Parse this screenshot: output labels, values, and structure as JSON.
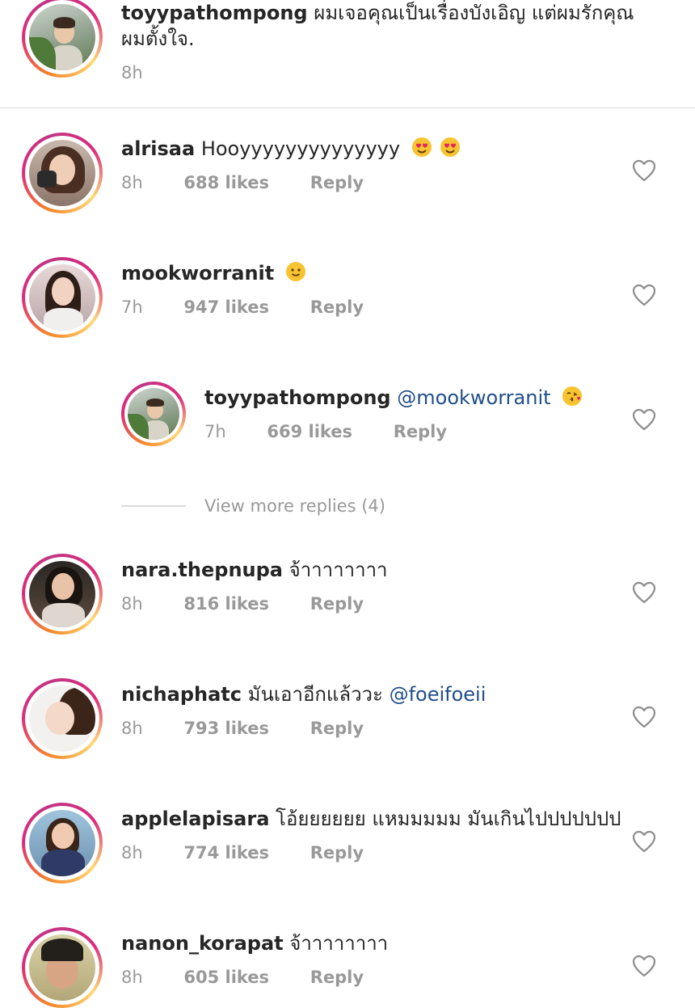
{
  "caption": {
    "username": "toyypathompong",
    "text_line1": "ผมเจอคุณเป็นเรื่องบังเอิญ แต่ผมรักคุณ",
    "text_line2": "ผมตั้งใจ.",
    "time": "8h"
  },
  "reply_label": "Reply",
  "comments": [
    {
      "username": "alrisaa",
      "text": "Hooyyyyyyyyyyyyyy",
      "emojis": [
        "heart-eyes",
        "heart-eyes"
      ],
      "time": "8h",
      "likes": "688 likes"
    },
    {
      "username": "mookworranit",
      "text": "",
      "emojis": [
        "slight-smile"
      ],
      "time": "7h",
      "likes": "947 likes"
    },
    {
      "username": "toyypathompong",
      "text": "",
      "mention": "@mookworranit",
      "emojis": [
        "kiss"
      ],
      "time": "7h",
      "likes": "669 likes",
      "is_reply": true
    },
    {
      "username": "nara.thepnupa",
      "text": "จ้าาาาาาาา",
      "time": "8h",
      "likes": "816 likes"
    },
    {
      "username": "nichaphatc",
      "text": "มันเอาอีกแล้ววะ",
      "mention": "@foeifoeii",
      "time": "8h",
      "likes": "793 likes"
    },
    {
      "username": "applelapisara",
      "text": "โอ้ยยยยยย แหมมมมม มันเกินไปปปปปปป",
      "time": "8h",
      "likes": "774 likes"
    },
    {
      "username": "nanon_korapat",
      "text": "จ้าาาาาาาา",
      "time": "8h",
      "likes": "605 likes"
    }
  ],
  "view_more_replies": "View more replies (4)",
  "icons": {
    "like": "heart-outline-icon",
    "story_ring": "story-ring"
  },
  "colors": {
    "mention": "#1f4e8a",
    "meta": "#999999",
    "text": "#262626",
    "ring_start": "#f58529",
    "ring_end": "#dd2a7b"
  }
}
